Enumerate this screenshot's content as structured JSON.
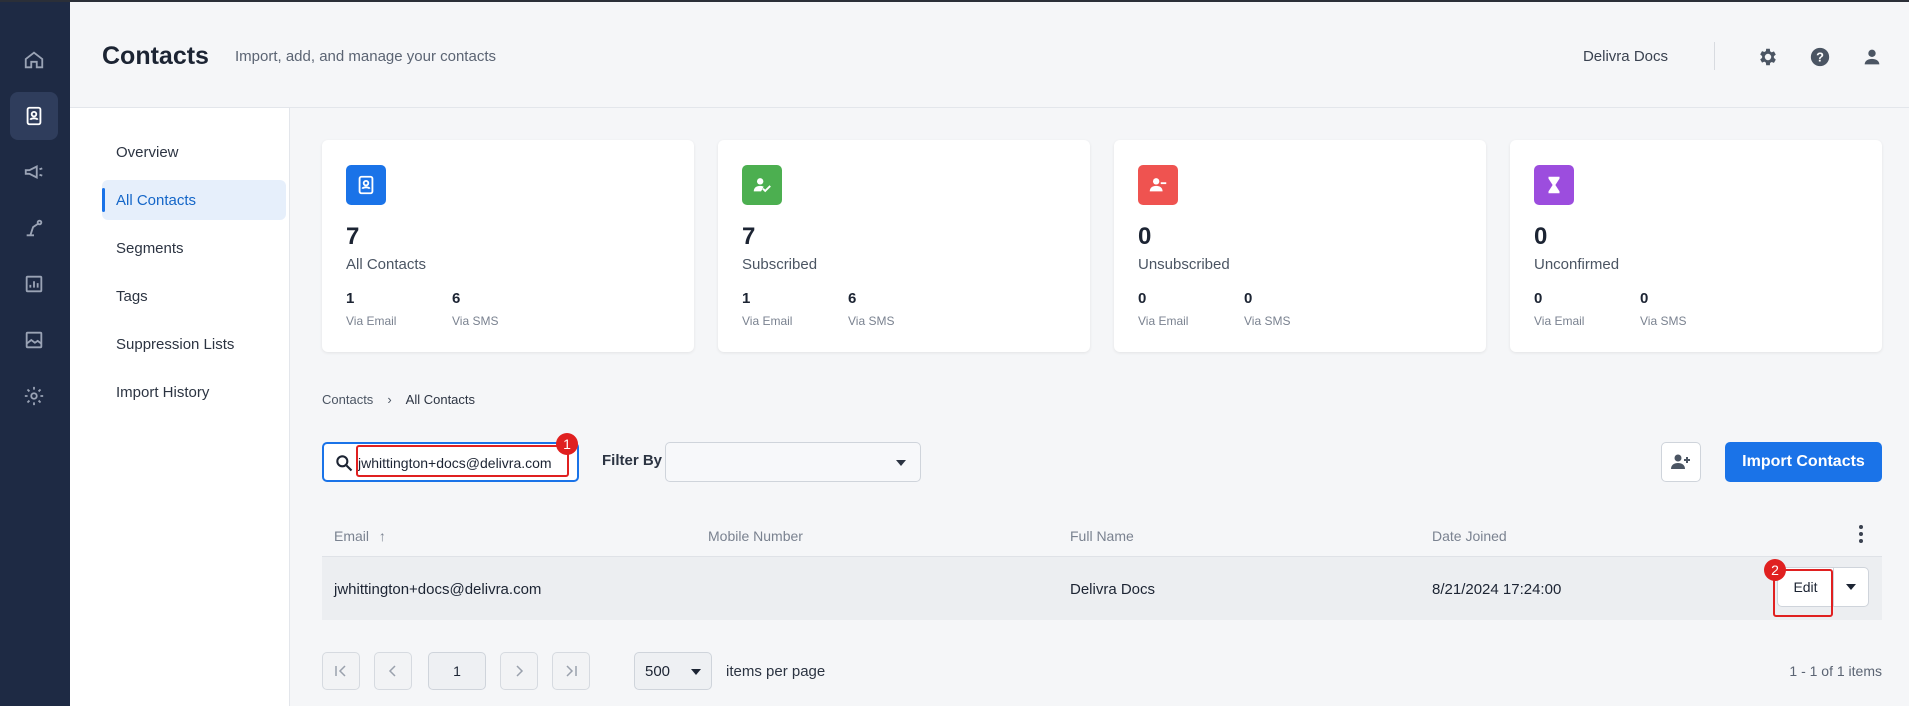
{
  "header": {
    "title": "Contacts",
    "subtitle": "Import, add, and manage your contacts",
    "account_name": "Delivra Docs"
  },
  "rail": {
    "items": [
      "home-icon",
      "contacts-icon",
      "megaphone-icon",
      "automation-icon",
      "reports-icon",
      "media-icon",
      "settings-icon"
    ]
  },
  "subnav": {
    "items": [
      {
        "label": "Overview"
      },
      {
        "label": "All Contacts",
        "active": true
      },
      {
        "label": "Segments"
      },
      {
        "label": "Tags"
      },
      {
        "label": "Suppression Lists"
      },
      {
        "label": "Import History"
      }
    ]
  },
  "stats": [
    {
      "value": "7",
      "label": "All Contacts",
      "email_num": "1",
      "email_label": "Via Email",
      "sms_num": "6",
      "sms_label": "Via SMS",
      "color": "#1a73e8"
    },
    {
      "value": "7",
      "label": "Subscribed",
      "email_num": "1",
      "email_label": "Via Email",
      "sms_num": "6",
      "sms_label": "Via SMS",
      "color": "#4caf50"
    },
    {
      "value": "0",
      "label": "Unsubscribed",
      "email_num": "0",
      "email_label": "Via Email",
      "sms_num": "0",
      "sms_label": "Via SMS",
      "color": "#ef5350"
    },
    {
      "value": "0",
      "label": "Unconfirmed",
      "email_num": "0",
      "email_label": "Via Email",
      "sms_num": "0",
      "sms_label": "Via SMS",
      "color": "#9c4dde"
    }
  ],
  "breadcrumb": {
    "root": "Contacts",
    "separator": "›",
    "current": "All Contacts"
  },
  "search": {
    "value": "jwhittington+docs@delivra.com"
  },
  "filter": {
    "label": "Filter By",
    "value": ""
  },
  "import_button": "Import Contacts",
  "table": {
    "columns": [
      "Email",
      "Mobile Number",
      "Full Name",
      "Date Joined"
    ],
    "sort_arrow": "↑",
    "rows": [
      {
        "email": "jwhittington+docs@delivra.com",
        "mobile": "",
        "full_name": "Delivra Docs",
        "date_joined": "8/21/2024 17:24:00",
        "action": "Edit"
      }
    ]
  },
  "pager": {
    "page": "1",
    "per_page": "500",
    "per_page_label": "items per page",
    "info": "1 - 1 of 1 items"
  },
  "annotations": [
    "1",
    "2"
  ],
  "colors": {
    "rail": "#1e2a44",
    "accent": "#1a73e8",
    "annotation": "#e02020"
  }
}
